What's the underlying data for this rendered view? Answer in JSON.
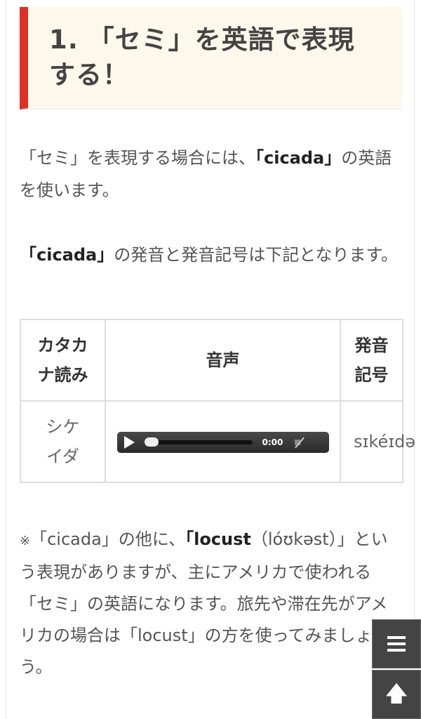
{
  "heading": {
    "line1": "1. 「セミ」を英語で表現",
    "line2": "する！"
  },
  "intro": {
    "before": "「セミ」を表現する場合には、",
    "term": "「cicada」",
    "after": "の英語を使います。"
  },
  "pronunciation_intro": {
    "term": "「cicada」",
    "after": "の発音と発音記号は下記となります。"
  },
  "table": {
    "headers": {
      "katakana": "カタカナ読み",
      "audio": "音声",
      "ipa": "発音記号"
    },
    "row": {
      "katakana": "シケイダ",
      "ipa": "sɪkéɪdə"
    }
  },
  "audio_player": {
    "time": "0:00"
  },
  "note": {
    "mark": "※",
    "before": "「cicada」の他に、",
    "term": "「locust",
    "ipa_part": "（lóʊkəst）」",
    "after": "という表現がありますが、主にアメリカで使われる「セミ」の英語になります。旅先や滞在先がアメリカの場合は「locust」の方を使ってみましょう。"
  },
  "icons": {
    "menu": "hamburger-menu-icon",
    "scroll_top": "arrow-up-icon"
  },
  "colors": {
    "accent_red": "#e02f24",
    "heading_bg": "#fcf9ec",
    "fab_bg": "#444444"
  }
}
